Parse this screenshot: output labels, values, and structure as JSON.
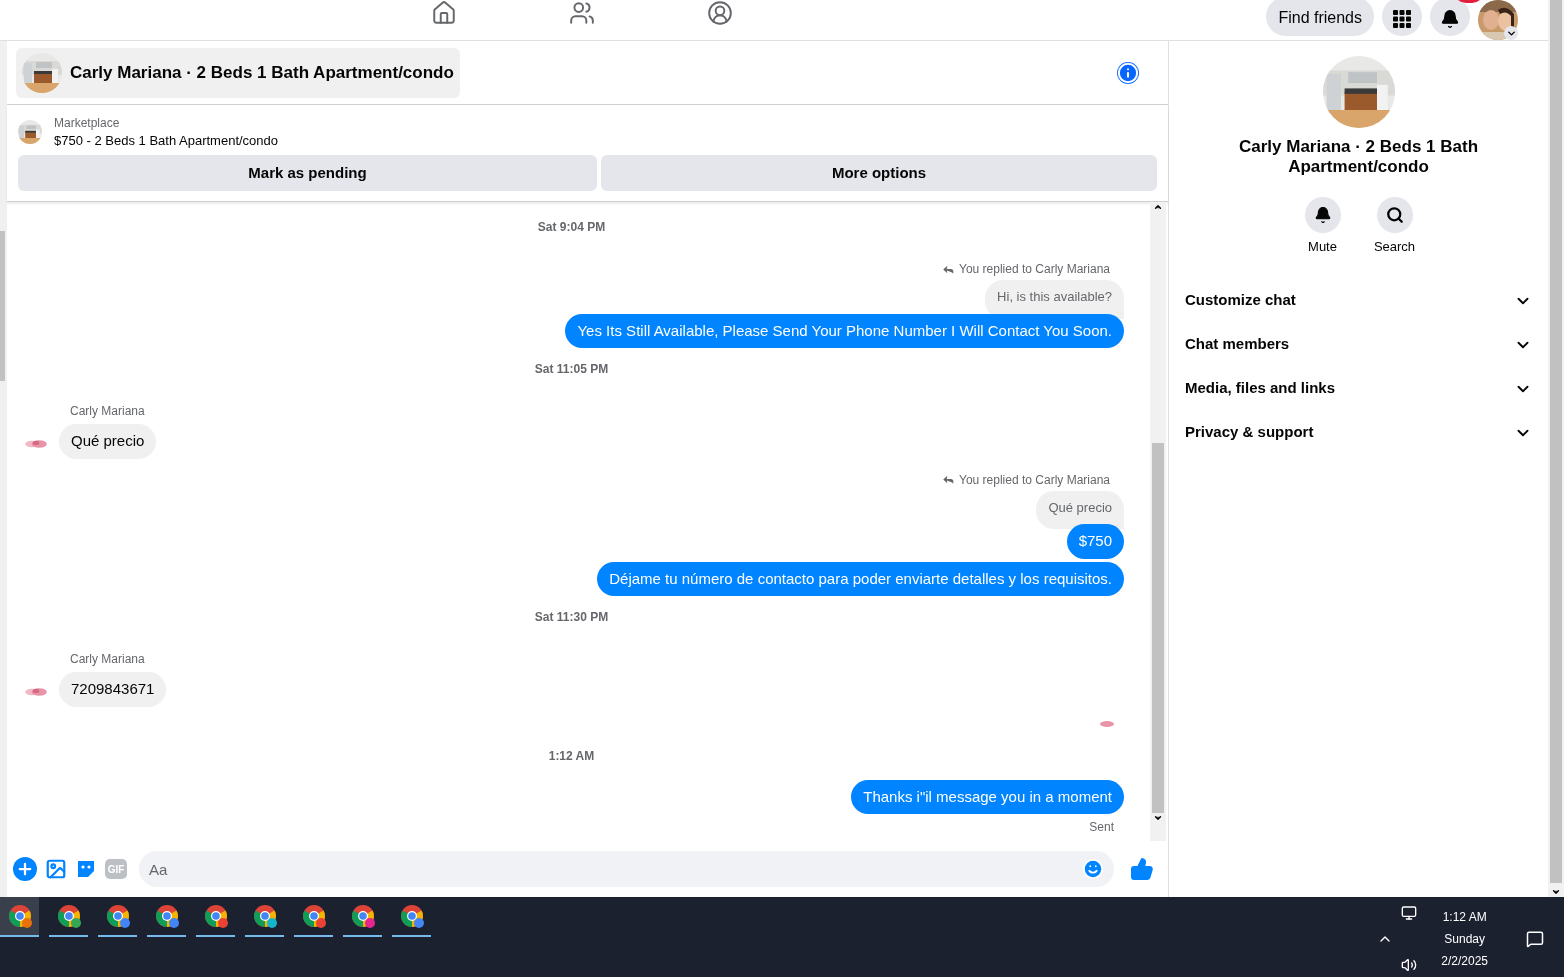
{
  "top_bar": {
    "nav": [
      {
        "kind": "home",
        "selected": false
      },
      {
        "kind": "friends",
        "selected": false
      },
      {
        "kind": "groups",
        "selected": false
      }
    ],
    "find_friends": "Find friends"
  },
  "chat_header": {
    "title": "Carly Mariana · 2 Beds 1 Bath Apartment/condo"
  },
  "listing": {
    "source": "Marketplace",
    "summary": "$750 - 2 Beds 1 Bath Apartment/condo",
    "actions": [
      "Mark as pending",
      "More options"
    ]
  },
  "messages": [
    {
      "kind": "time",
      "text": "Sat 9:04 PM"
    },
    {
      "kind": "reply_note",
      "text": "You replied to Carly Mariana"
    },
    {
      "kind": "quote",
      "text": "Hi, is this available?"
    },
    {
      "kind": "out",
      "text": "Yes Its Still Available, Please Send Your Phone Number I Will Contact You Soon."
    },
    {
      "kind": "time",
      "text": "Sat 11:05 PM"
    },
    {
      "kind": "in",
      "sender": "Carly Mariana",
      "text": "Qué precio"
    },
    {
      "kind": "reply_note",
      "text": "You replied to Carly Mariana"
    },
    {
      "kind": "quote",
      "text": "Qué precio"
    },
    {
      "kind": "out",
      "text": "$750"
    },
    {
      "kind": "out",
      "text": "Déjame tu número de contacto para poder enviarte detalles y los requisitos."
    },
    {
      "kind": "time",
      "text": "Sat 11:30 PM"
    },
    {
      "kind": "in",
      "sender": "Carly Mariana",
      "text": "7209843671"
    },
    {
      "kind": "seen"
    },
    {
      "kind": "time",
      "text": "1:12 AM"
    },
    {
      "kind": "out",
      "text": "Thanks i\"il message you in a moment"
    },
    {
      "kind": "status",
      "text": "Sent"
    }
  ],
  "composer": {
    "gif": "GIF",
    "placeholder": "Aa"
  },
  "details": {
    "title": "Carly Mariana · 2 Beds 1 Bath Apartment/condo",
    "actions": [
      {
        "kind": "mute",
        "label": "Mute"
      },
      {
        "kind": "search",
        "label": "Search"
      }
    ],
    "sections": [
      {
        "label": "Customize chat",
        "expanded": false
      },
      {
        "label": "Chat members",
        "expanded": false
      },
      {
        "label": "Media, files and links",
        "expanded": false
      },
      {
        "label": "Privacy & support",
        "expanded": false
      }
    ]
  },
  "taskbar": {
    "apps": [
      {
        "color": "#e8710a",
        "selected": true
      },
      {
        "color": "#34a853",
        "selected": false
      },
      {
        "color": "#4285f4",
        "selected": false
      },
      {
        "color": "#4285f4",
        "selected": false
      },
      {
        "color": "#ea4335",
        "selected": false
      },
      {
        "color": "#12b5cb",
        "selected": false
      },
      {
        "color": "#ea4335",
        "selected": false
      },
      {
        "color": "#e52592",
        "selected": false
      },
      {
        "color": "#4285f4",
        "selected": false
      }
    ],
    "time": "1:12 AM",
    "day": "Sunday",
    "date": "2/2/2025"
  }
}
